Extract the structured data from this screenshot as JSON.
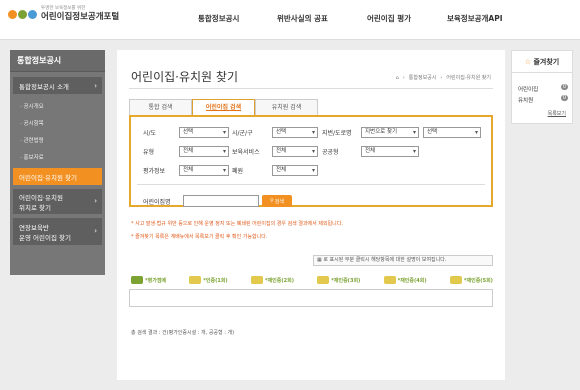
{
  "header": {
    "logo_tagline": "투명한 보육정보를 위한",
    "logo_title": "어린이집정보공개포털",
    "nav": [
      "통합정보공시",
      "위반사실의 공표",
      "어린이집 평가",
      "보육정보공개API"
    ]
  },
  "sidebar": {
    "title": "통합정보공시",
    "section1": "통합정보공시 소개",
    "subitems": [
      "공시개요",
      "공시항목",
      "관련법령",
      "홍보자료"
    ],
    "active_item": "어린이집·유치원 찾기",
    "item3_line1": "어린이집·유치원",
    "item3_line2": "위치로 찾기",
    "item4_line1": "연장보육반",
    "item4_line2": "운영 어린이집 찾기"
  },
  "main": {
    "title": "어린이집·유치원 찾기",
    "breadcrumb": [
      "통합정보공시",
      "어린이집·유치원 찾기"
    ],
    "tabs": [
      "통합 검색",
      "어린이집 검색",
      "유치원 검색"
    ],
    "filters": {
      "sido_label": "시/도",
      "sido_value": "선택",
      "sigungu_label": "시/군/구",
      "sigungu_value": "선택",
      "addr_label": "지번/도로명",
      "addr_value": "지번으로 찾기",
      "addr_sub_value": "선택",
      "type_label": "유형",
      "type_value": "전체",
      "service_label": "보육서비스",
      "service_value": "전체",
      "public_label": "공공형",
      "public_value": "전체",
      "eval_label": "평가정보",
      "eval_value": "전체",
      "close_label": "폐원",
      "close_value": "전체",
      "name_label": "어린이집명",
      "name_value": "",
      "search_button": "검색"
    },
    "notices": [
      "* 사고 발생·법규 위반 등으로 인해 운영 정지 또는 폐쇄된 어린이집의 경우 검색 결과에서 제외됩니다.",
      "* 즐겨찾기 목록은 계배뉴에서 목록보기 클릭 후 확인 가능합니다."
    ],
    "legend_tip": "로 표시된 부분 클릭시 해당항목에 대한 설명이 보여집니다.",
    "badges": [
      "*평가점메",
      "*인증(1회)",
      "*재인증(2회)",
      "*재인증(3회)",
      "*재인증(4회)",
      "*재인증(5회)"
    ],
    "badge_colors": [
      "#7ba232",
      "#e2c84c",
      "#e2c84c",
      "#e2c84c",
      "#e2c84c",
      "#e2c84c"
    ],
    "result_text": "총 검색 결과 : 건(평가인증시설 : 개, 공공형 : 개)"
  },
  "favorites": {
    "title": "즐겨찾기",
    "rows": [
      {
        "label": "어린이집",
        "count": "0"
      },
      {
        "label": "유치원",
        "count": "0"
      }
    ],
    "more": "목록보기"
  }
}
